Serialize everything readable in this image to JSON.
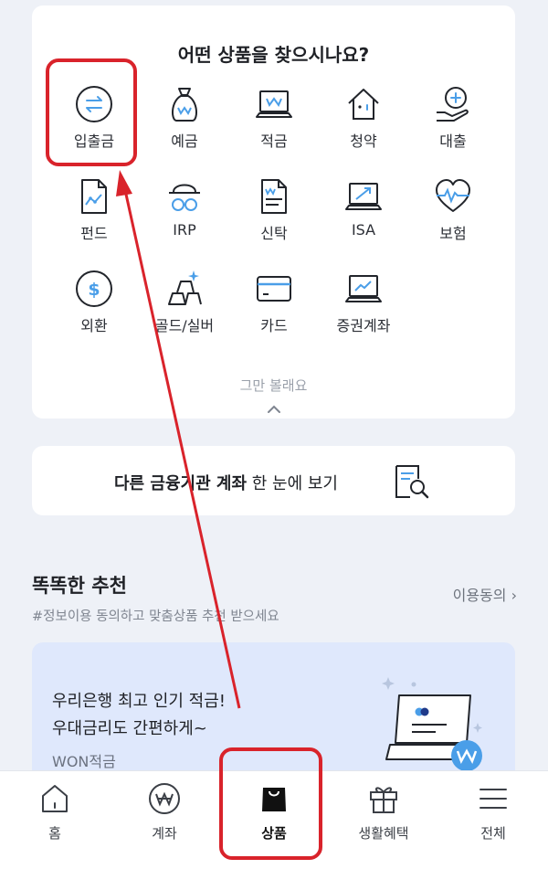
{
  "products": {
    "title": "어떤 상품을 찾으시나요?",
    "items": [
      {
        "label": "입출금",
        "icon": "transfer-icon"
      },
      {
        "label": "예금",
        "icon": "money-bag-icon"
      },
      {
        "label": "적금",
        "icon": "laptop-won-icon"
      },
      {
        "label": "청약",
        "icon": "house-icon"
      },
      {
        "label": "대출",
        "icon": "hand-plus-icon"
      },
      {
        "label": "펀드",
        "icon": "fund-document-icon"
      },
      {
        "label": "IRP",
        "icon": "person-glasses-icon"
      },
      {
        "label": "신탁",
        "icon": "trust-document-icon"
      },
      {
        "label": "ISA",
        "icon": "laptop-chart-icon"
      },
      {
        "label": "보험",
        "icon": "heart-pulse-icon"
      },
      {
        "label": "외환",
        "icon": "dollar-coin-icon"
      },
      {
        "label": "골드/실버",
        "icon": "gold-bars-icon"
      },
      {
        "label": "카드",
        "icon": "card-icon"
      },
      {
        "label": "증권계좌",
        "icon": "laptop-stock-icon"
      }
    ],
    "less_label": "그만 볼래요"
  },
  "other_bank": {
    "bold": "다른 금융기관 계좌",
    "rest": " 한 눈에 보기",
    "icon": "document-search-icon"
  },
  "recommend": {
    "title": "똑똑한 추천",
    "subtitle": "#정보이용 동의하고 맞춤상품 추천 받으세요",
    "consent_link": "이용동의"
  },
  "promo": {
    "line1": "우리은행 최고 인기 적금!",
    "line2": "우대금리도 간편하게~",
    "tag": "WON적금"
  },
  "nav": [
    {
      "label": "홈",
      "icon": "home-icon"
    },
    {
      "label": "계좌",
      "icon": "won-coin-icon"
    },
    {
      "label": "상품",
      "icon": "shopping-bag-icon"
    },
    {
      "label": "생활혜택",
      "icon": "gift-icon"
    },
    {
      "label": "전체",
      "icon": "menu-icon"
    }
  ],
  "colors": {
    "accent": "#4a9ee8",
    "annotation": "#d9232b",
    "background": "#eef1f7",
    "promo_bg": "#dfe8fc"
  }
}
